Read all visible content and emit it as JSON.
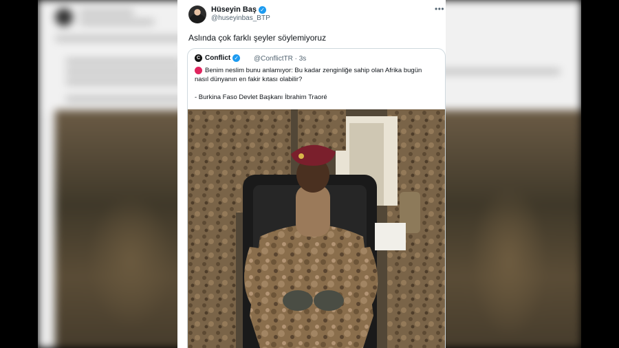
{
  "tweet": {
    "author_name": "Hüseyin Baş",
    "author_handle": "@huseyinbas_BTP",
    "text": "Aslında çok farklı şeyler söylemiyoruz",
    "more_icon": "more-horizontal-icon"
  },
  "quote": {
    "author_name": "Conflict",
    "author_handle": "@ConflictTR · 3s",
    "line1": "Benim neslim bunu anlamıyor: Bu kadar zenginliğe sahip olan Afrika bugün",
    "line2": "nasıl dünyanın en fakir kıtası olabilir?",
    "line3": "- Burkina Faso Devlet Başkanı İbrahim Traoré",
    "photo_subject": "military-officer-photo"
  },
  "colors": {
    "verified": "#1d9bf0",
    "alert_dot": "#e0245e",
    "text": "#0f1419",
    "muted": "#536471"
  }
}
